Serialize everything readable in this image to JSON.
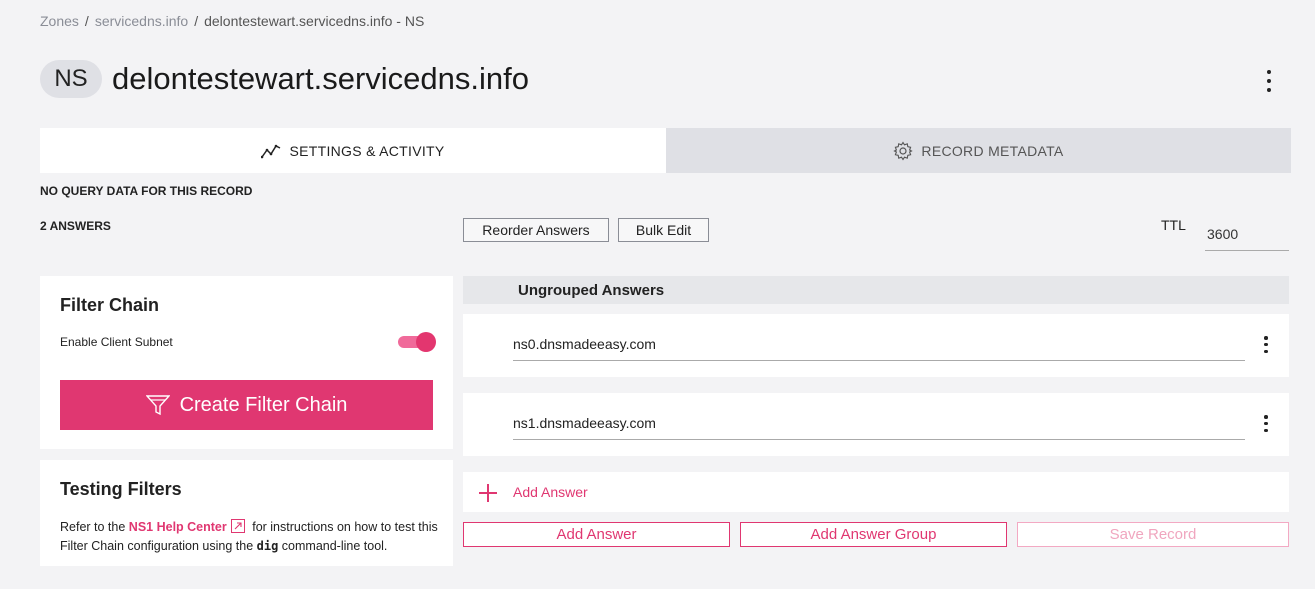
{
  "breadcrumb": {
    "items": [
      "Zones",
      "servicedns.info"
    ],
    "current": "delontestewart.servicedns.info - NS",
    "separator": "/"
  },
  "header": {
    "badge": "NS",
    "title": "delontestewart.servicedns.info"
  },
  "tabs": [
    {
      "label": "SETTINGS & ACTIVITY",
      "icon": "activity-chart-icon",
      "active": true
    },
    {
      "label": "RECORD METADATA",
      "icon": "gear-icon",
      "active": false
    }
  ],
  "status": {
    "no_query": "NO QUERY DATA FOR THIS RECORD",
    "answers_count": "2 ANSWERS"
  },
  "toolbar": {
    "reorder_label": "Reorder Answers",
    "bulk_edit_label": "Bulk Edit",
    "ttl_label": "TTL",
    "ttl_value": "3600"
  },
  "filter_chain": {
    "title": "Filter Chain",
    "subnet_label": "Enable Client Subnet",
    "subnet_enabled": true,
    "create_label": "Create Filter Chain"
  },
  "testing": {
    "title": "Testing Filters",
    "text_before": "Refer to the ",
    "link": "NS1 Help Center",
    "text_middle": " for instructions on how to test this Filter Chain configuration using the ",
    "code": "dig",
    "text_after": " command-line tool."
  },
  "answers": {
    "group_title": "Ungrouped Answers",
    "items": [
      "ns0.dnsmadeeasy.com",
      "ns1.dnsmadeeasy.com"
    ],
    "add_link": "Add Answer"
  },
  "actions": {
    "add_answer": "Add Answer",
    "add_group": "Add Answer Group",
    "save": "Save Record"
  },
  "colors": {
    "accent": "#e03771",
    "background": "#f3f3f5",
    "tab_inactive": "#dfe0e5"
  }
}
